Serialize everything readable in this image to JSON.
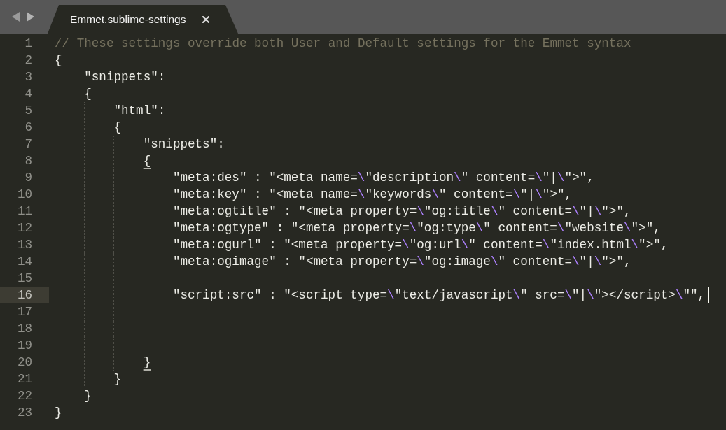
{
  "tabs": [
    {
      "title": "Emmet.sublime-settings",
      "selected": true
    }
  ],
  "lines": [
    {
      "number": "1",
      "current": false,
      "tokens": [
        {
          "kind": "comment",
          "text": "// These settings override both User and Default settings for the Emmet syntax"
        }
      ]
    },
    {
      "number": "2",
      "current": false,
      "tokens": [
        {
          "kind": "text",
          "text": "{"
        }
      ],
      "children": [
        {
          "number": "3",
          "current": false,
          "tokens": [
            {
              "kind": "text",
              "text": "\"snippets\":"
            }
          ]
        },
        {
          "number": "4",
          "current": false,
          "tokens": [
            {
              "kind": "text",
              "text": "{"
            }
          ],
          "children": [
            {
              "number": "5",
              "current": false,
              "tokens": [
                {
                  "kind": "text",
                  "text": "\"html\":"
                }
              ]
            },
            {
              "number": "6",
              "current": false,
              "tokens": [
                {
                  "kind": "text",
                  "text": "{"
                }
              ],
              "children": [
                {
                  "number": "7",
                  "current": false,
                  "tokens": [
                    {
                      "kind": "text",
                      "text": "\"snippets\":"
                    }
                  ]
                },
                {
                  "number": "8",
                  "current": false,
                  "tokens": [
                    {
                      "kind": "matched-brace",
                      "text": "{"
                    }
                  ],
                  "children": [
                    {
                      "number": "9",
                      "current": false,
                      "tokens": [
                        {
                          "kind": "text",
                          "text": "\"meta:des\" : \"<meta name="
                        },
                        {
                          "kind": "escape",
                          "text": "\\"
                        },
                        {
                          "kind": "text",
                          "text": "\"description"
                        },
                        {
                          "kind": "escape",
                          "text": "\\"
                        },
                        {
                          "kind": "text",
                          "text": "\" content="
                        },
                        {
                          "kind": "escape",
                          "text": "\\"
                        },
                        {
                          "kind": "text",
                          "text": "\"|"
                        },
                        {
                          "kind": "escape",
                          "text": "\\"
                        },
                        {
                          "kind": "text",
                          "text": "\">\","
                        }
                      ]
                    },
                    {
                      "number": "10",
                      "current": false,
                      "tokens": [
                        {
                          "kind": "text",
                          "text": "\"meta:key\" : \"<meta name="
                        },
                        {
                          "kind": "escape",
                          "text": "\\"
                        },
                        {
                          "kind": "text",
                          "text": "\"keywords"
                        },
                        {
                          "kind": "escape",
                          "text": "\\"
                        },
                        {
                          "kind": "text",
                          "text": "\" content="
                        },
                        {
                          "kind": "escape",
                          "text": "\\"
                        },
                        {
                          "kind": "text",
                          "text": "\"|"
                        },
                        {
                          "kind": "escape",
                          "text": "\\"
                        },
                        {
                          "kind": "text",
                          "text": "\">\","
                        }
                      ]
                    },
                    {
                      "number": "11",
                      "current": false,
                      "tokens": [
                        {
                          "kind": "text",
                          "text": "\"meta:ogtitle\" : \"<meta property="
                        },
                        {
                          "kind": "escape",
                          "text": "\\"
                        },
                        {
                          "kind": "text",
                          "text": "\"og:title"
                        },
                        {
                          "kind": "escape",
                          "text": "\\"
                        },
                        {
                          "kind": "text",
                          "text": "\" content="
                        },
                        {
                          "kind": "escape",
                          "text": "\\"
                        },
                        {
                          "kind": "text",
                          "text": "\"|"
                        },
                        {
                          "kind": "escape",
                          "text": "\\"
                        },
                        {
                          "kind": "text",
                          "text": "\">\","
                        }
                      ]
                    },
                    {
                      "number": "12",
                      "current": false,
                      "tokens": [
                        {
                          "kind": "text",
                          "text": "\"meta:ogtype\" : \"<meta property="
                        },
                        {
                          "kind": "escape",
                          "text": "\\"
                        },
                        {
                          "kind": "text",
                          "text": "\"og:type"
                        },
                        {
                          "kind": "escape",
                          "text": "\\"
                        },
                        {
                          "kind": "text",
                          "text": "\" content="
                        },
                        {
                          "kind": "escape",
                          "text": "\\"
                        },
                        {
                          "kind": "text",
                          "text": "\"website"
                        },
                        {
                          "kind": "escape",
                          "text": "\\"
                        },
                        {
                          "kind": "text",
                          "text": "\">\","
                        }
                      ]
                    },
                    {
                      "number": "13",
                      "current": false,
                      "tokens": [
                        {
                          "kind": "text",
                          "text": "\"meta:ogurl\" : \"<meta property="
                        },
                        {
                          "kind": "escape",
                          "text": "\\"
                        },
                        {
                          "kind": "text",
                          "text": "\"og:url"
                        },
                        {
                          "kind": "escape",
                          "text": "\\"
                        },
                        {
                          "kind": "text",
                          "text": "\" content="
                        },
                        {
                          "kind": "escape",
                          "text": "\\"
                        },
                        {
                          "kind": "text",
                          "text": "\"index.html"
                        },
                        {
                          "kind": "escape",
                          "text": "\\"
                        },
                        {
                          "kind": "text",
                          "text": "\">\","
                        }
                      ]
                    },
                    {
                      "number": "14",
                      "current": false,
                      "tokens": [
                        {
                          "kind": "text",
                          "text": "\"meta:ogimage\" : \"<meta property="
                        },
                        {
                          "kind": "escape",
                          "text": "\\"
                        },
                        {
                          "kind": "text",
                          "text": "\"og:image"
                        },
                        {
                          "kind": "escape",
                          "text": "\\"
                        },
                        {
                          "kind": "text",
                          "text": "\" content="
                        },
                        {
                          "kind": "escape",
                          "text": "\\"
                        },
                        {
                          "kind": "text",
                          "text": "\"|"
                        },
                        {
                          "kind": "escape",
                          "text": "\\"
                        },
                        {
                          "kind": "text",
                          "text": "\">\","
                        }
                      ]
                    },
                    {
                      "number": "15",
                      "current": false
                    },
                    {
                      "number": "16",
                      "current": true,
                      "tokens": [
                        {
                          "kind": "text",
                          "text": "\"script:src\" : \"<script type="
                        },
                        {
                          "kind": "escape",
                          "text": "\\"
                        },
                        {
                          "kind": "text",
                          "text": "\"text/javascript"
                        },
                        {
                          "kind": "escape",
                          "text": "\\"
                        },
                        {
                          "kind": "text",
                          "text": "\" src="
                        },
                        {
                          "kind": "escape",
                          "text": "\\"
                        },
                        {
                          "kind": "text",
                          "text": "\"|"
                        },
                        {
                          "kind": "escape",
                          "text": "\\"
                        },
                        {
                          "kind": "text",
                          "text": "\"></script>"
                        },
                        {
                          "kind": "escape",
                          "text": "\\"
                        },
                        {
                          "kind": "text",
                          "text": "\"\","
                        }
                      ]
                    }
                  ]
                },
                {
                  "number": "17",
                  "current": false
                },
                {
                  "number": "18",
                  "current": false
                },
                {
                  "number": "19",
                  "current": false
                },
                {
                  "number": "20",
                  "current": false,
                  "tokens": [
                    {
                      "kind": "matched-brace",
                      "text": "}"
                    }
                  ]
                }
              ]
            },
            {
              "number": "21",
              "current": false,
              "tokens": [
                {
                  "kind": "text",
                  "text": "}"
                }
              ]
            }
          ]
        },
        {
          "number": "22",
          "current": false,
          "tokens": [
            {
              "kind": "text",
              "text": "}"
            }
          ]
        }
      ]
    },
    {
      "number": "23",
      "current": false,
      "tokens": [
        {
          "kind": "text",
          "text": "}"
        }
      ]
    }
  ]
}
